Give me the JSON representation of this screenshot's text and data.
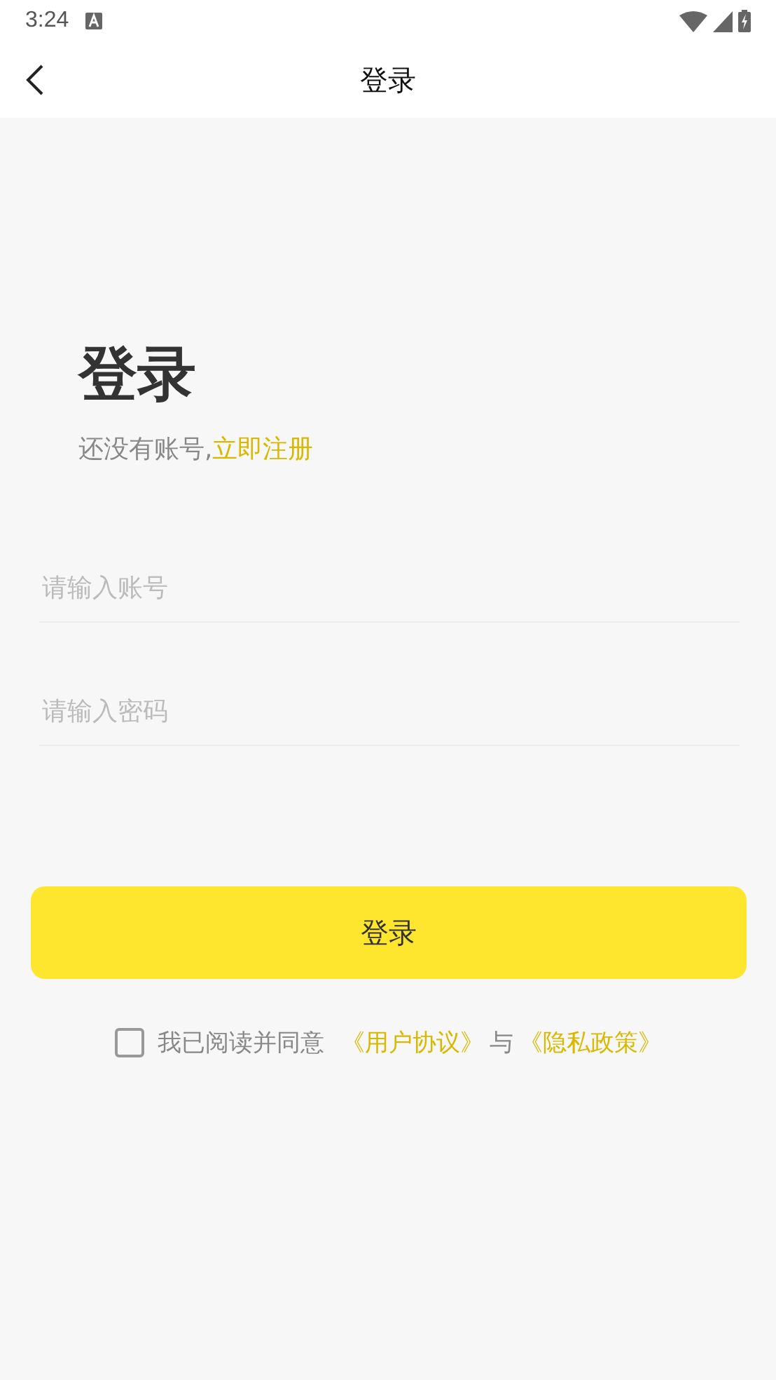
{
  "status_bar": {
    "time": "3:24"
  },
  "nav": {
    "title": "登录"
  },
  "heading": "登录",
  "register_prompt": {
    "text": "还没有账号,",
    "link": "立即注册"
  },
  "fields": [
    {
      "placeholder": "请输入账号"
    },
    {
      "placeholder": "请输入密码"
    }
  ],
  "login_button": "登录",
  "agreement": {
    "checked": false,
    "text": "我已阅读并同意",
    "link_1": "《用户协议》",
    "joiner": "与",
    "link_2": "《隐私政策》"
  }
}
